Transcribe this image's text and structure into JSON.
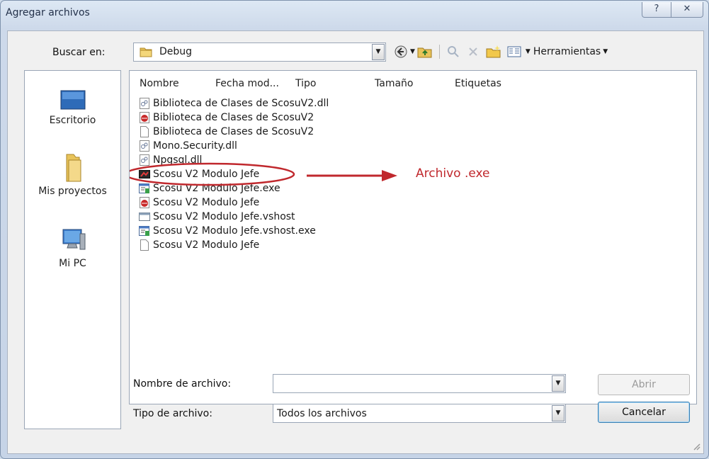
{
  "window": {
    "title": "Agregar archivos",
    "help_glyph": "?",
    "close_glyph": "✕"
  },
  "lookin": {
    "label": "Buscar en:",
    "value": "Debug",
    "tools_label": "Herramientas"
  },
  "places": [
    {
      "label": "Escritorio",
      "icon": "desktop-icon"
    },
    {
      "label": "Mis proyectos",
      "icon": "folder-icon"
    },
    {
      "label": "Mi PC",
      "icon": "computer-icon"
    }
  ],
  "columns": [
    "Nombre",
    "Fecha mod...",
    "Tipo",
    "Tamaño",
    "Etiquetas"
  ],
  "files": [
    {
      "name": "Biblioteca de Clases de ScosuV2.dll",
      "icon": "dll-icon"
    },
    {
      "name": "Biblioteca de Clases de ScosuV2",
      "icon": "debug-icon"
    },
    {
      "name": "Biblioteca de Clases de ScosuV2",
      "icon": "blank-file-icon"
    },
    {
      "name": "Mono.Security.dll",
      "icon": "dll-icon"
    },
    {
      "name": "Npgsql.dll",
      "icon": "dll-icon"
    },
    {
      "name": "Scosu V2 Modulo Jefe",
      "icon": "app-exe-icon"
    },
    {
      "name": "Scosu V2 Modulo Jefe.exe",
      "icon": "config-icon"
    },
    {
      "name": "Scosu V2 Modulo Jefe",
      "icon": "debug-icon"
    },
    {
      "name": "Scosu V2 Modulo Jefe.vshost",
      "icon": "window-app-icon"
    },
    {
      "name": "Scosu V2 Modulo Jefe.vshost.exe",
      "icon": "config-icon"
    },
    {
      "name": "Scosu V2 Modulo Jefe",
      "icon": "blank-file-icon"
    }
  ],
  "annotation": {
    "text": "Archivo .exe",
    "color": "#c0282d"
  },
  "filename": {
    "label": "Nombre de archivo:",
    "value": ""
  },
  "filetype": {
    "label": "Tipo de archivo:",
    "value": "Todos los archivos"
  },
  "buttons": {
    "open": "Abrir",
    "cancel": "Cancelar"
  }
}
